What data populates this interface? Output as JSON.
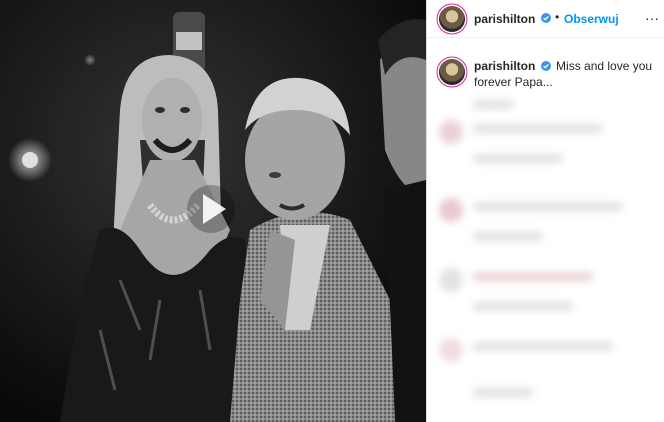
{
  "post": {
    "username": "parishilton",
    "follow_label": "Obserwuj",
    "separator": "•",
    "more_label": "···",
    "caption_text": "Miss and love you forever Papa..."
  },
  "colors": {
    "accent": "#0095f6",
    "verified": "#3897f0",
    "story_ring": "#d6249f"
  },
  "icons": {
    "play": "play-icon",
    "verified": "verified-badge-icon",
    "more": "more-options-icon"
  }
}
